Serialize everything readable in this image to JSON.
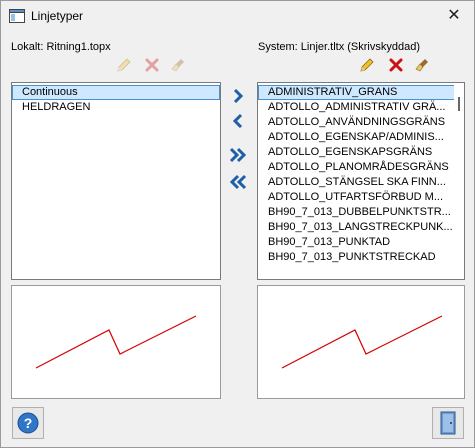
{
  "window": {
    "title": "Linjetyper",
    "close_glyph": "✕"
  },
  "left": {
    "label": "Lokalt: Ritning1.topx",
    "tools": [
      "pencil-icon",
      "delete-x-icon",
      "broom-icon"
    ],
    "tools_enabled": false,
    "items": [
      "Continuous",
      "HELDRAGEN"
    ],
    "selected_index": 0
  },
  "right": {
    "label": "System: Linjer.tltx (Skrivskyddad)",
    "tools": [
      "pencil-icon",
      "delete-x-icon",
      "broom-icon"
    ],
    "tools_enabled": true,
    "items": [
      "ADMINISTRATIV_GRANS",
      "ADTOLLO_ADMINISTRATIV GRÄ...",
      "ADTOLLO_ANVÄNDNINGSGRÄNS",
      "ADTOLLO_EGENSKAP/ADMINIS...",
      "ADTOLLO_EGENSKAPSGRÄNS",
      "ADTOLLO_PLANOMRÅDESGRÄNS",
      "ADTOLLO_STÄNGSEL SKA FINN...",
      "ADTOLLO_UTFARTSFÖRBUD M...",
      "BH90_7_013_DUBBELPUNKTSTR...",
      "BH90_7_013_LANGSTRECKPUNK...",
      "BH90_7_013_PUNKTAD",
      "BH90_7_013_PUNKTSTRECKAD"
    ],
    "selected_index": 0
  },
  "transfer_buttons": [
    "chevron-right-icon",
    "chevron-left-icon",
    "double-chevron-right-icon",
    "double-chevron-left-icon"
  ],
  "colors": {
    "preview_line": "#d40000",
    "arrow_blue": "#1f5fa8",
    "selection": "#cde8ff"
  },
  "footer": {
    "help_icon": "help-icon",
    "exit_icon": "door-exit-icon"
  }
}
